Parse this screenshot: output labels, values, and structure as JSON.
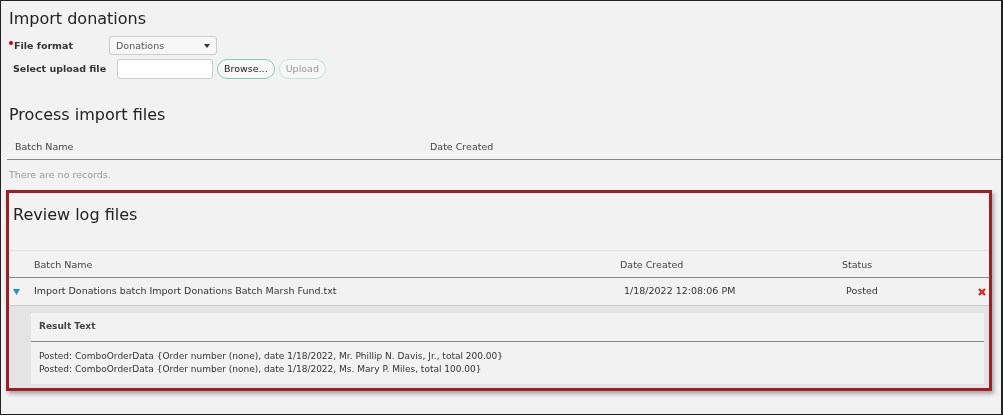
{
  "import_section": {
    "title": "Import donations",
    "fields": [
      {
        "kind": "select",
        "label": "File format",
        "required": true,
        "value": "Donations"
      },
      {
        "kind": "file",
        "label": "Select upload file",
        "required": false,
        "browse_button": "Browse...",
        "upload_button": "Upload",
        "upload_disabled": true
      }
    ]
  },
  "process_section": {
    "title": "Process import files",
    "columns": [
      "Batch Name",
      "Date Created"
    ],
    "empty_message": "There are no records."
  },
  "review_section": {
    "title": "Review log files",
    "columns": [
      "Batch Name",
      "Date Created",
      "Status"
    ],
    "rows": [
      {
        "batch_name": "Import Donations batch Import Donations Batch Marsh Fund.txt",
        "date_created": "1/18/2022 12:08:06 PM",
        "status": "Posted",
        "expanded": true,
        "result_header": "Result Text",
        "results": [
          "Posted: ComboOrderData {Order number (none), date 1/18/2022, Mr. Phillip N. Davis, Jr., total 200.00}",
          "Posted: ComboOrderData {Order number (none), date 1/18/2022, Ms. Mary P. Miles, total 100.00}"
        ]
      }
    ]
  }
}
